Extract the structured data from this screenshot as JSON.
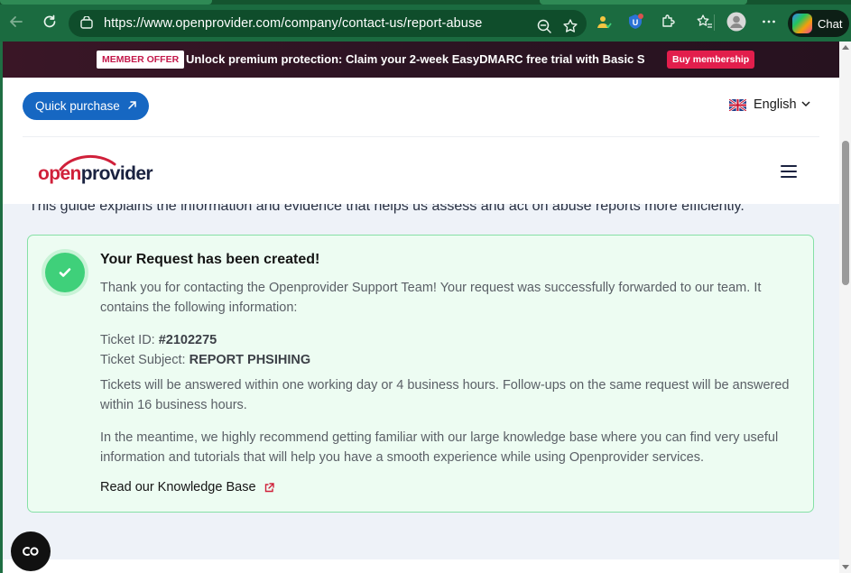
{
  "browser": {
    "url": "https://www.openprovider.com/company/contact-us/report-abuse",
    "chat_label": "Chat",
    "icons": {
      "back": "back-arrow-icon",
      "reload": "reload-icon",
      "site_info": "site-info-icon",
      "zoom": "zoom-icon",
      "favorite": "star-icon",
      "extensions": "puzzle-icon",
      "favorites": "favorites-icon",
      "profile": "avatar",
      "menu": "more-icon"
    },
    "accent": "#1b6b40"
  },
  "promo": {
    "badge": "MEMBER OFFER",
    "message": "Unlock premium protection: Claim your 2-week EasyDMARC free trial with Basic S",
    "cta": "Buy membership"
  },
  "header": {
    "quick_purchase": "Quick purchase",
    "language": "English",
    "logo_open": "open",
    "logo_provider": "provider"
  },
  "main": {
    "intro": "This guide explains the information and evidence that helps us assess and act on abuse reports more efficiently.",
    "card": {
      "title": "Your Request has been created!",
      "p1": "Thank you for contacting the Openprovider Support Team! Your request was successfully forwarded to our team. It contains the following information:",
      "ticket_id_label": "Ticket ID: ",
      "ticket_id": "#2102275",
      "ticket_subject_label": "Ticket Subject: ",
      "ticket_subject": "REPORT PHSIHING",
      "p3": "Tickets will be answered within one working day or 4 business hours. Follow-ups on the same request will be answered within 16 business hours.",
      "p4": "In the meantime, we highly recommend getting familiar with our large knowledge base where you can find very useful information and tutorials that will help you have a smooth experience while using Openprovider services.",
      "kb_link": "Read our Knowledge Base"
    }
  },
  "colors": {
    "primary_blue": "#1667c2",
    "brand_red": "#d0203a",
    "success_green": "#3fd07a",
    "card_bg": "#edfcf2"
  }
}
